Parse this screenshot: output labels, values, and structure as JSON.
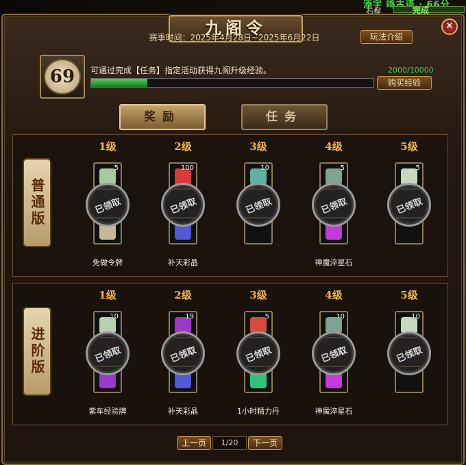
{
  "hud": {
    "garbled_top": "添字  鸣古语 · 66分",
    "name": "石榴",
    "status": "完成"
  },
  "window": {
    "title": "九阁令",
    "season": "赛季时间：2025年4月28日~2025年6月22日",
    "help_label": "玩法介绍",
    "close_glyph": "✕"
  },
  "level": {
    "value": "69",
    "exp_text": "可通过完成【任务】指定活动获得九阁升级经验。",
    "exp_value": "2000/10000",
    "exp_fraction": 0.2,
    "buy_label": "购买经验"
  },
  "tabs": [
    {
      "label": "奖励",
      "active": true
    },
    {
      "label": "任务",
      "active": false
    }
  ],
  "tiers": [
    {
      "label": "普通版",
      "levels": [
        {
          "label": "1级",
          "top_count": "5",
          "top_color": "#a9c7a0",
          "bot_color": "#c8b899",
          "claimed": "已领取",
          "name": "免做令牌"
        },
        {
          "label": "2级",
          "top_count": "100",
          "top_color": "#d83a3a",
          "bot_color": "#4f5ad9",
          "claimed": "已领取",
          "name": "补天彩晶"
        },
        {
          "label": "3级",
          "top_count": "10",
          "top_color": "#5fb0a2",
          "bot_color": "",
          "claimed": "已领取",
          "name": ""
        },
        {
          "label": "4级",
          "top_count": "5",
          "top_color": "#7fa38f",
          "bot_color": "#c43ad9",
          "claimed": "已领取",
          "name": "神魔淬星石"
        },
        {
          "label": "5级",
          "top_count": "5",
          "top_color": "#c7d8c0",
          "bot_color": "",
          "claimed": "已领取",
          "name": ""
        }
      ]
    },
    {
      "label": "进阶版",
      "levels": [
        {
          "label": "1级",
          "top_count": "10",
          "top_color": "#b7d1b0",
          "bot_color": "#9b38c9",
          "claimed": "已领取",
          "name": "紫车经验牌"
        },
        {
          "label": "2级",
          "top_count": "19",
          "top_color": "#9b38c9",
          "bot_color": "#4f5ad9",
          "claimed": "已领取",
          "name": "补天彩晶"
        },
        {
          "label": "3级",
          "top_count": "5",
          "top_color": "#d84a3a",
          "bot_color": "#2fc27a",
          "claimed": "已领取",
          "name": "1小时精力丹"
        },
        {
          "label": "4级",
          "top_count": "10",
          "top_color": "#7fa38f",
          "bot_color": "#c43ad9",
          "claimed": "已领取",
          "name": "神魔淬星石"
        },
        {
          "label": "5级",
          "top_count": "10",
          "top_color": "#c7d8c0",
          "bot_color": "",
          "claimed": "已领取",
          "name": ""
        }
      ]
    }
  ],
  "pager": {
    "prev_label": "上一页",
    "info": "1/20",
    "next_label": "下一页"
  }
}
